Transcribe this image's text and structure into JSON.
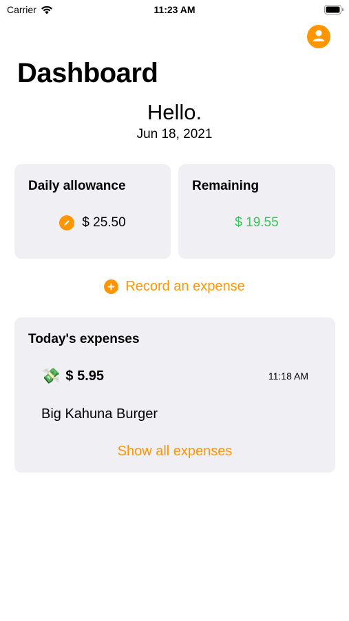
{
  "status_bar": {
    "carrier": "Carrier",
    "time": "11:23 AM",
    "icons": [
      "wifi-icon",
      "battery-icon"
    ]
  },
  "header": {
    "title": "Dashboard",
    "greeting": "Hello.",
    "date": "Jun 18, 2021",
    "profile_icon": "person-icon"
  },
  "allowance_card": {
    "title": "Daily allowance",
    "value": "$ 25.50",
    "edit_icon": "pencil-icon"
  },
  "remaining_card": {
    "title": "Remaining",
    "value": "$ 19.55"
  },
  "record_action": {
    "label": "Record an expense",
    "icon": "plus-icon"
  },
  "expenses_card": {
    "title": "Today's expenses",
    "items": [
      {
        "icon": "money-with-wings-icon",
        "amount": "$ 5.95",
        "time": "11:18 AM",
        "description": "Big Kahuna Burger"
      }
    ],
    "show_all_label": "Show all expenses"
  },
  "colors": {
    "accent": "#ff9500",
    "positive": "#34c759",
    "card_background": "#efeff4"
  }
}
